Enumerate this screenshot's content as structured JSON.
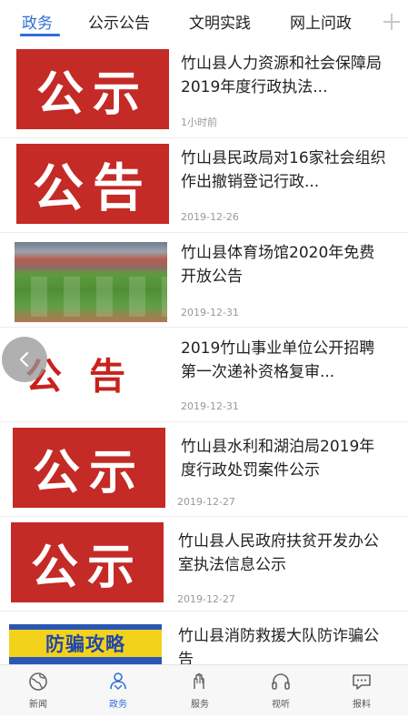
{
  "tabs": [
    {
      "label": "政务",
      "active": true
    },
    {
      "label": "公示公告",
      "active": false
    },
    {
      "label": "文明实践",
      "active": false
    },
    {
      "label": "网上问政",
      "active": false
    }
  ],
  "add_tab_icon": "plus-icon",
  "colors": {
    "accent": "#2f6fd4",
    "thumb_red": "#c42a26",
    "time_gray": "#999999"
  },
  "news": [
    {
      "title": "竹山县人力资源和社会保障局2019年度行政执法...",
      "time": "1小时前",
      "thumb_text": "公示"
    },
    {
      "title": "竹山县民政局对16家社会组织作出撤销登记行政...",
      "time": "2019-12-26",
      "thumb_text": "公告"
    },
    {
      "title": "竹山县体育场馆2020年免费开放公告",
      "time": "2019-12-31",
      "thumb_text": ""
    },
    {
      "title": "2019竹山事业单位公开招聘第一次递补资格复审...",
      "time": "2019-12-31",
      "thumb_text": "公告"
    },
    {
      "title": "竹山县水利和湖泊局2019年度行政处罚案件公示",
      "time": "2019-12-27",
      "thumb_text": "公示"
    },
    {
      "title": "竹山县人民政府扶贫开发办公室执法信息公示",
      "time": "2019-12-27",
      "thumb_text": "公示"
    },
    {
      "title": "竹山县消防救援大队防诈骗公告",
      "time": "",
      "thumb_text": "防骗攻略"
    }
  ],
  "back_button_icon": "chevron-left-icon",
  "bottom_nav": [
    {
      "label": "新闻",
      "icon": "globe-icon",
      "active": false
    },
    {
      "label": "政务",
      "icon": "people-icon",
      "active": true
    },
    {
      "label": "服务",
      "icon": "hands-icon",
      "active": false
    },
    {
      "label": "视听",
      "icon": "headphones-icon",
      "active": false
    },
    {
      "label": "报料",
      "icon": "chat-icon",
      "active": false
    }
  ]
}
